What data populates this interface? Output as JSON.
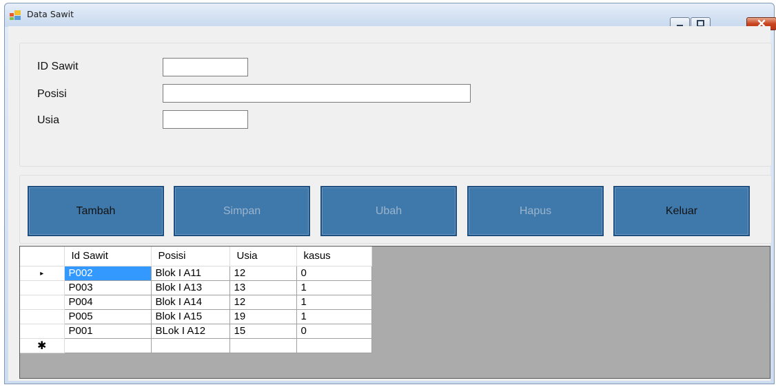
{
  "window": {
    "title": "Data Sawit",
    "app_icon": "form-icon",
    "controls": [
      "minimize-icon",
      "maximize-icon",
      "close-icon"
    ]
  },
  "form": {
    "id_label": "ID Sawit",
    "id_value": "",
    "posisi_label": "Posisi",
    "posisi_value": "",
    "usia_label": "Usia",
    "usia_value": ""
  },
  "buttons": {
    "tambah": "Tambah",
    "simpan": "Simpan",
    "ubah": "Ubah",
    "hapus": "Hapus",
    "keluar": "Keluar",
    "enabled_color": "#121212",
    "disabled_color": "#9cb4cc",
    "background": "#3f79ab"
  },
  "grid": {
    "columns": [
      "Id Sawit",
      "Posisi",
      "Usia",
      "kasus"
    ],
    "rows": [
      [
        "P002",
        "Blok I A11",
        "12",
        "0"
      ],
      [
        "P003",
        "Blok I A13",
        "13",
        "1"
      ],
      [
        "P004",
        "Blok I A14",
        "12",
        "1"
      ],
      [
        "P005",
        "Blok I A15",
        "19",
        "1"
      ],
      [
        "P001",
        "BLok I A12",
        "15",
        "0"
      ]
    ],
    "current_row_marker": "▸",
    "new_row_marker": "✱",
    "selection_color": "#3399ff"
  }
}
